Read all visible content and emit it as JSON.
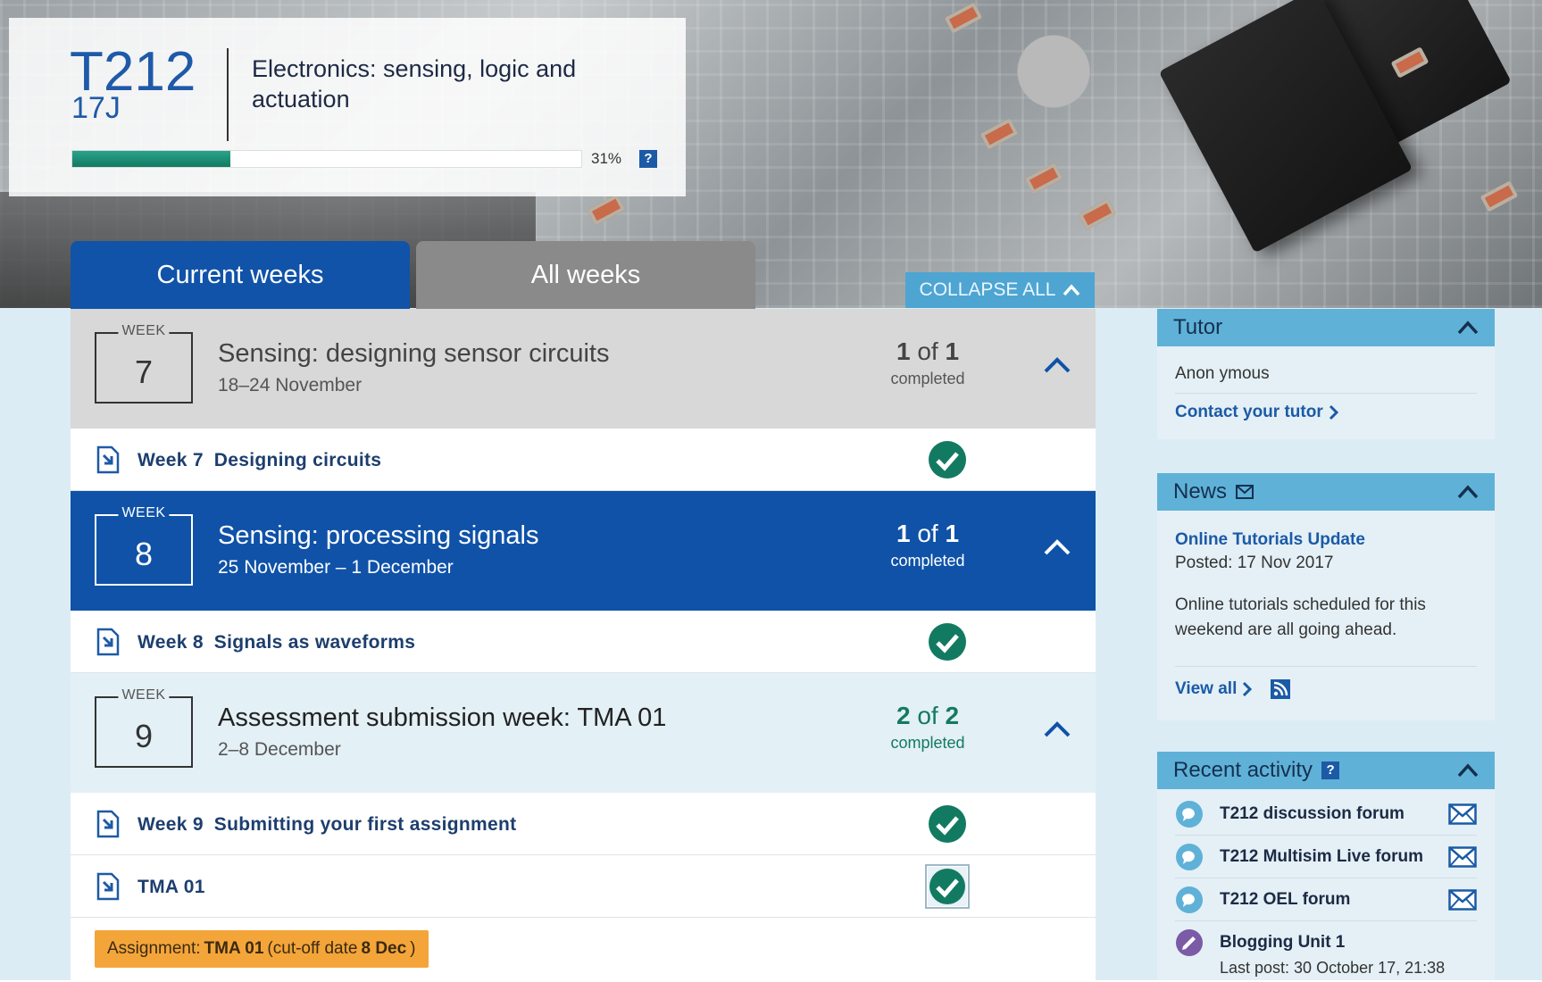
{
  "course": {
    "code": "T212",
    "presentation": "17J",
    "title": "Electronics: sensing, logic and actuation",
    "progress_text": "31%",
    "progress_value": 0.31,
    "help_label": "?"
  },
  "tabs": {
    "current": "Current weeks",
    "all": "All weeks"
  },
  "collapse_all_label": "COLLAPSE ALL",
  "weeks": [
    {
      "box_label": "WEEK",
      "number": "7",
      "title": "Sensing: designing sensor circuits",
      "dates": "18–24 November",
      "done": "1",
      "of": "of",
      "total": "1",
      "completed_label": "completed",
      "activities": [
        {
          "week_label": "Week 7",
          "title": "Designing circuits"
        }
      ]
    },
    {
      "box_label": "WEEK",
      "number": "8",
      "title": "Sensing: processing signals",
      "dates": "25 November – 1 December",
      "done": "1",
      "of": "of",
      "total": "1",
      "completed_label": "completed",
      "activities": [
        {
          "week_label": "Week 8",
          "title": "Signals as waveforms"
        }
      ]
    },
    {
      "box_label": "WEEK",
      "number": "9",
      "title": "Assessment submission week: TMA 01",
      "dates": "2–8 December",
      "done": "2",
      "of": "of",
      "total": "2",
      "completed_label": "completed",
      "activities": [
        {
          "week_label": "Week 9",
          "title": "Submitting your first assignment"
        },
        {
          "week_label": "",
          "title": "TMA 01"
        }
      ]
    }
  ],
  "assignment": {
    "prefix": "Assignment:",
    "name": "TMA 01",
    "cutoff_prefix": "(cut-off date",
    "cutoff_date": "8 Dec",
    "cutoff_suffix": ")"
  },
  "sidebar": {
    "tutor": {
      "title": "Tutor",
      "name": "Anon ymous",
      "contact_label": "Contact your tutor"
    },
    "news": {
      "title": "News",
      "item_title": "Online Tutorials Update",
      "posted": "Posted: 17 Nov 2017",
      "text": "Online tutorials scheduled for this weekend are all going ahead.",
      "view_all": "View all"
    },
    "recent": {
      "title": "Recent activity",
      "help_label": "?",
      "items": [
        {
          "label": "T212 discussion forum"
        },
        {
          "label": "T212 Multisim Live forum"
        },
        {
          "label": "T212 OEL forum"
        },
        {
          "label": "Blogging Unit 1",
          "sub": "Last post: 30 October 17, 21:38"
        }
      ]
    }
  },
  "colors": {
    "brand_blue": "#1053a8",
    "teal_check": "#137a62",
    "sidebar_head": "#5fb1d7",
    "assignment_orange": "#f4a53a"
  }
}
